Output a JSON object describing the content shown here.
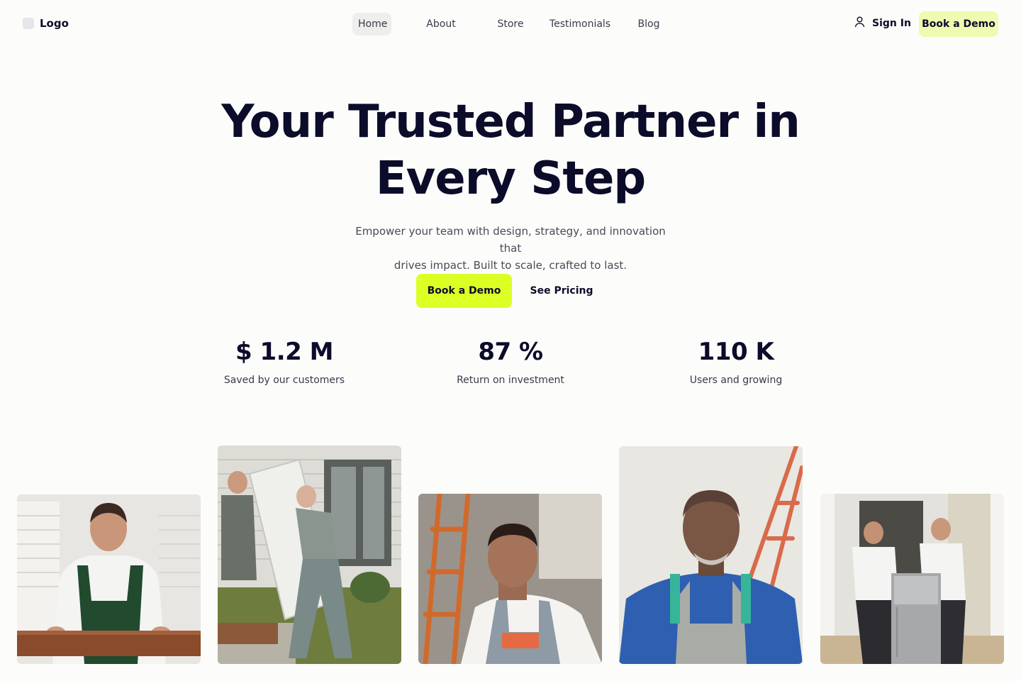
{
  "nav": {
    "logo_text": "Logo",
    "items": [
      {
        "label": "Home",
        "active": true
      },
      {
        "label": "About",
        "active": false
      },
      {
        "label": "Store",
        "active": false
      },
      {
        "label": "Testimonials",
        "active": false
      },
      {
        "label": "Blog",
        "active": false
      }
    ],
    "signin_label": "Sign In",
    "cta_label": "Book a Demo"
  },
  "hero": {
    "title_line1": "Your Trusted Partner in",
    "title_line2": "Every Step",
    "subtitle_line1": "Empower your team with design, strategy, and innovation that",
    "subtitle_line2": "drives impact. Built to scale, crafted to last.",
    "primary_cta": "Book a Demo",
    "secondary_cta": "See Pricing"
  },
  "stats": [
    {
      "value": "$ 1.2 M",
      "label": "Saved by our customers"
    },
    {
      "value": "87 %",
      "label": "Return on investment"
    },
    {
      "value": "110 K",
      "label": "Users and growing"
    }
  ],
  "colors": {
    "accent": "#dcff24",
    "accent_soft": "#eefbb0",
    "text_dark": "#0b0b2a",
    "background": "#fcfcfa"
  }
}
